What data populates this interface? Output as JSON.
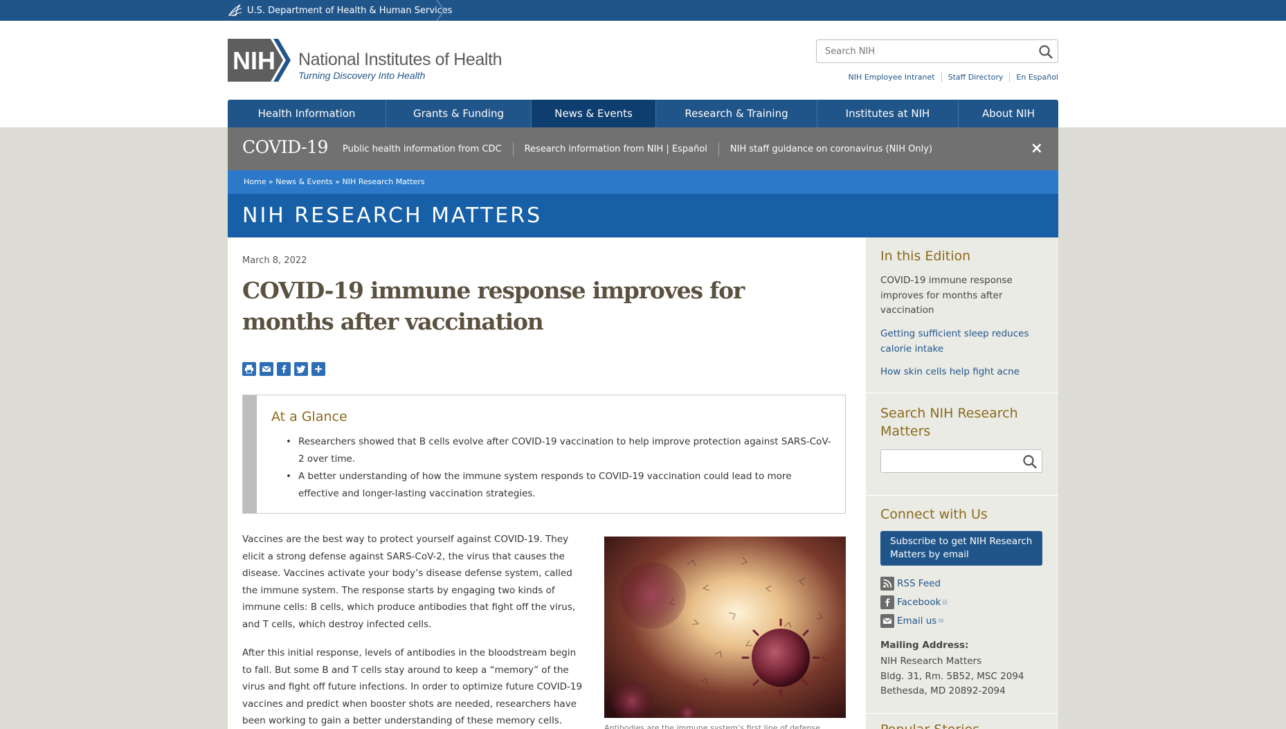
{
  "hhs": {
    "label": "U.S. Department of Health & Human Services"
  },
  "header": {
    "logo_mark": "NIH",
    "title": "National Institutes of Health",
    "tagline": "Turning Discovery Into Health",
    "search_placeholder": "Search NIH",
    "util_links": [
      "NIH Employee Intranet",
      "Staff Directory",
      "En Español"
    ]
  },
  "nav": {
    "items": [
      {
        "label": "Health Information",
        "active": false
      },
      {
        "label": "Grants & Funding",
        "active": false
      },
      {
        "label": "News & Events",
        "active": true
      },
      {
        "label": "Research & Training",
        "active": false
      },
      {
        "label": "Institutes at NIH",
        "active": false
      },
      {
        "label": "About NIH",
        "active": false
      }
    ]
  },
  "covid": {
    "title": "COVID-19",
    "links": [
      "Public health information from CDC",
      "Research information from NIH | Español",
      "NIH staff guidance on coronavirus (NIH Only)"
    ],
    "close": "×"
  },
  "breadcrumb": {
    "home": "Home",
    "sep": " » ",
    "news": "News & Events",
    "current": "NIH Research Matters"
  },
  "banner": {
    "title": "NIH RESEARCH MATTERS"
  },
  "article": {
    "date": "March 8, 2022",
    "headline": "COVID-19 immune response improves for months after vaccination",
    "share_icons": [
      "print-icon",
      "email-icon",
      "facebook-icon",
      "twitter-icon",
      "plus-icon"
    ],
    "glance": {
      "title": "At a Glance",
      "items": [
        "Researchers showed that B cells evolve after COVID-19 vaccination to help improve protection against SARS-CoV-2 over time.",
        "A better understanding of how the immune system responds to COVID-19 vaccination could lead to more effective and longer-lasting vaccination strategies."
      ]
    },
    "paragraphs": [
      "Vaccines are the best way to protect yourself against COVID-19. They elicit a strong defense against SARS-CoV-2, the virus that causes the disease. Vaccines activate your body’s disease defense system, called the immune system. The response starts by engaging two kinds of immune cells: B cells, which produce antibodies that fight off the virus, and T cells, which destroy infected cells.",
      "After this initial response, levels of antibodies in the bloodstream begin to fall. But some B and T cells stay around to keep a “memory” of the virus and fight off future infections. In order to optimize future COVID-19 vaccines and predict when booster shots are needed, researchers have been working to gain a better understanding of these memory cells."
    ],
    "caption": "Antibodies are the immune system’s first line of defense..."
  },
  "sidebar": {
    "edition_title": "In this Edition",
    "edition_current": "COVID-19 immune response improves for months after vaccination",
    "edition_links": [
      "Getting sufficient sleep reduces calorie intake",
      "How skin cells help fight acne"
    ],
    "search_title": "Search NIH Research Matters",
    "connect_title": "Connect with Us",
    "subscribe": "Subscribe to get NIH Research Matters by email",
    "connect_links": [
      "RSS Feed",
      "Facebook",
      "Email us"
    ],
    "mailing_label": "Mailing Address:",
    "mailing_lines": [
      "NIH Research Matters",
      "Bldg. 31, Rm. 5B52, MSC 2094",
      "Bethesda, MD 20892-2094"
    ],
    "popular_title": "Popular Stories"
  }
}
